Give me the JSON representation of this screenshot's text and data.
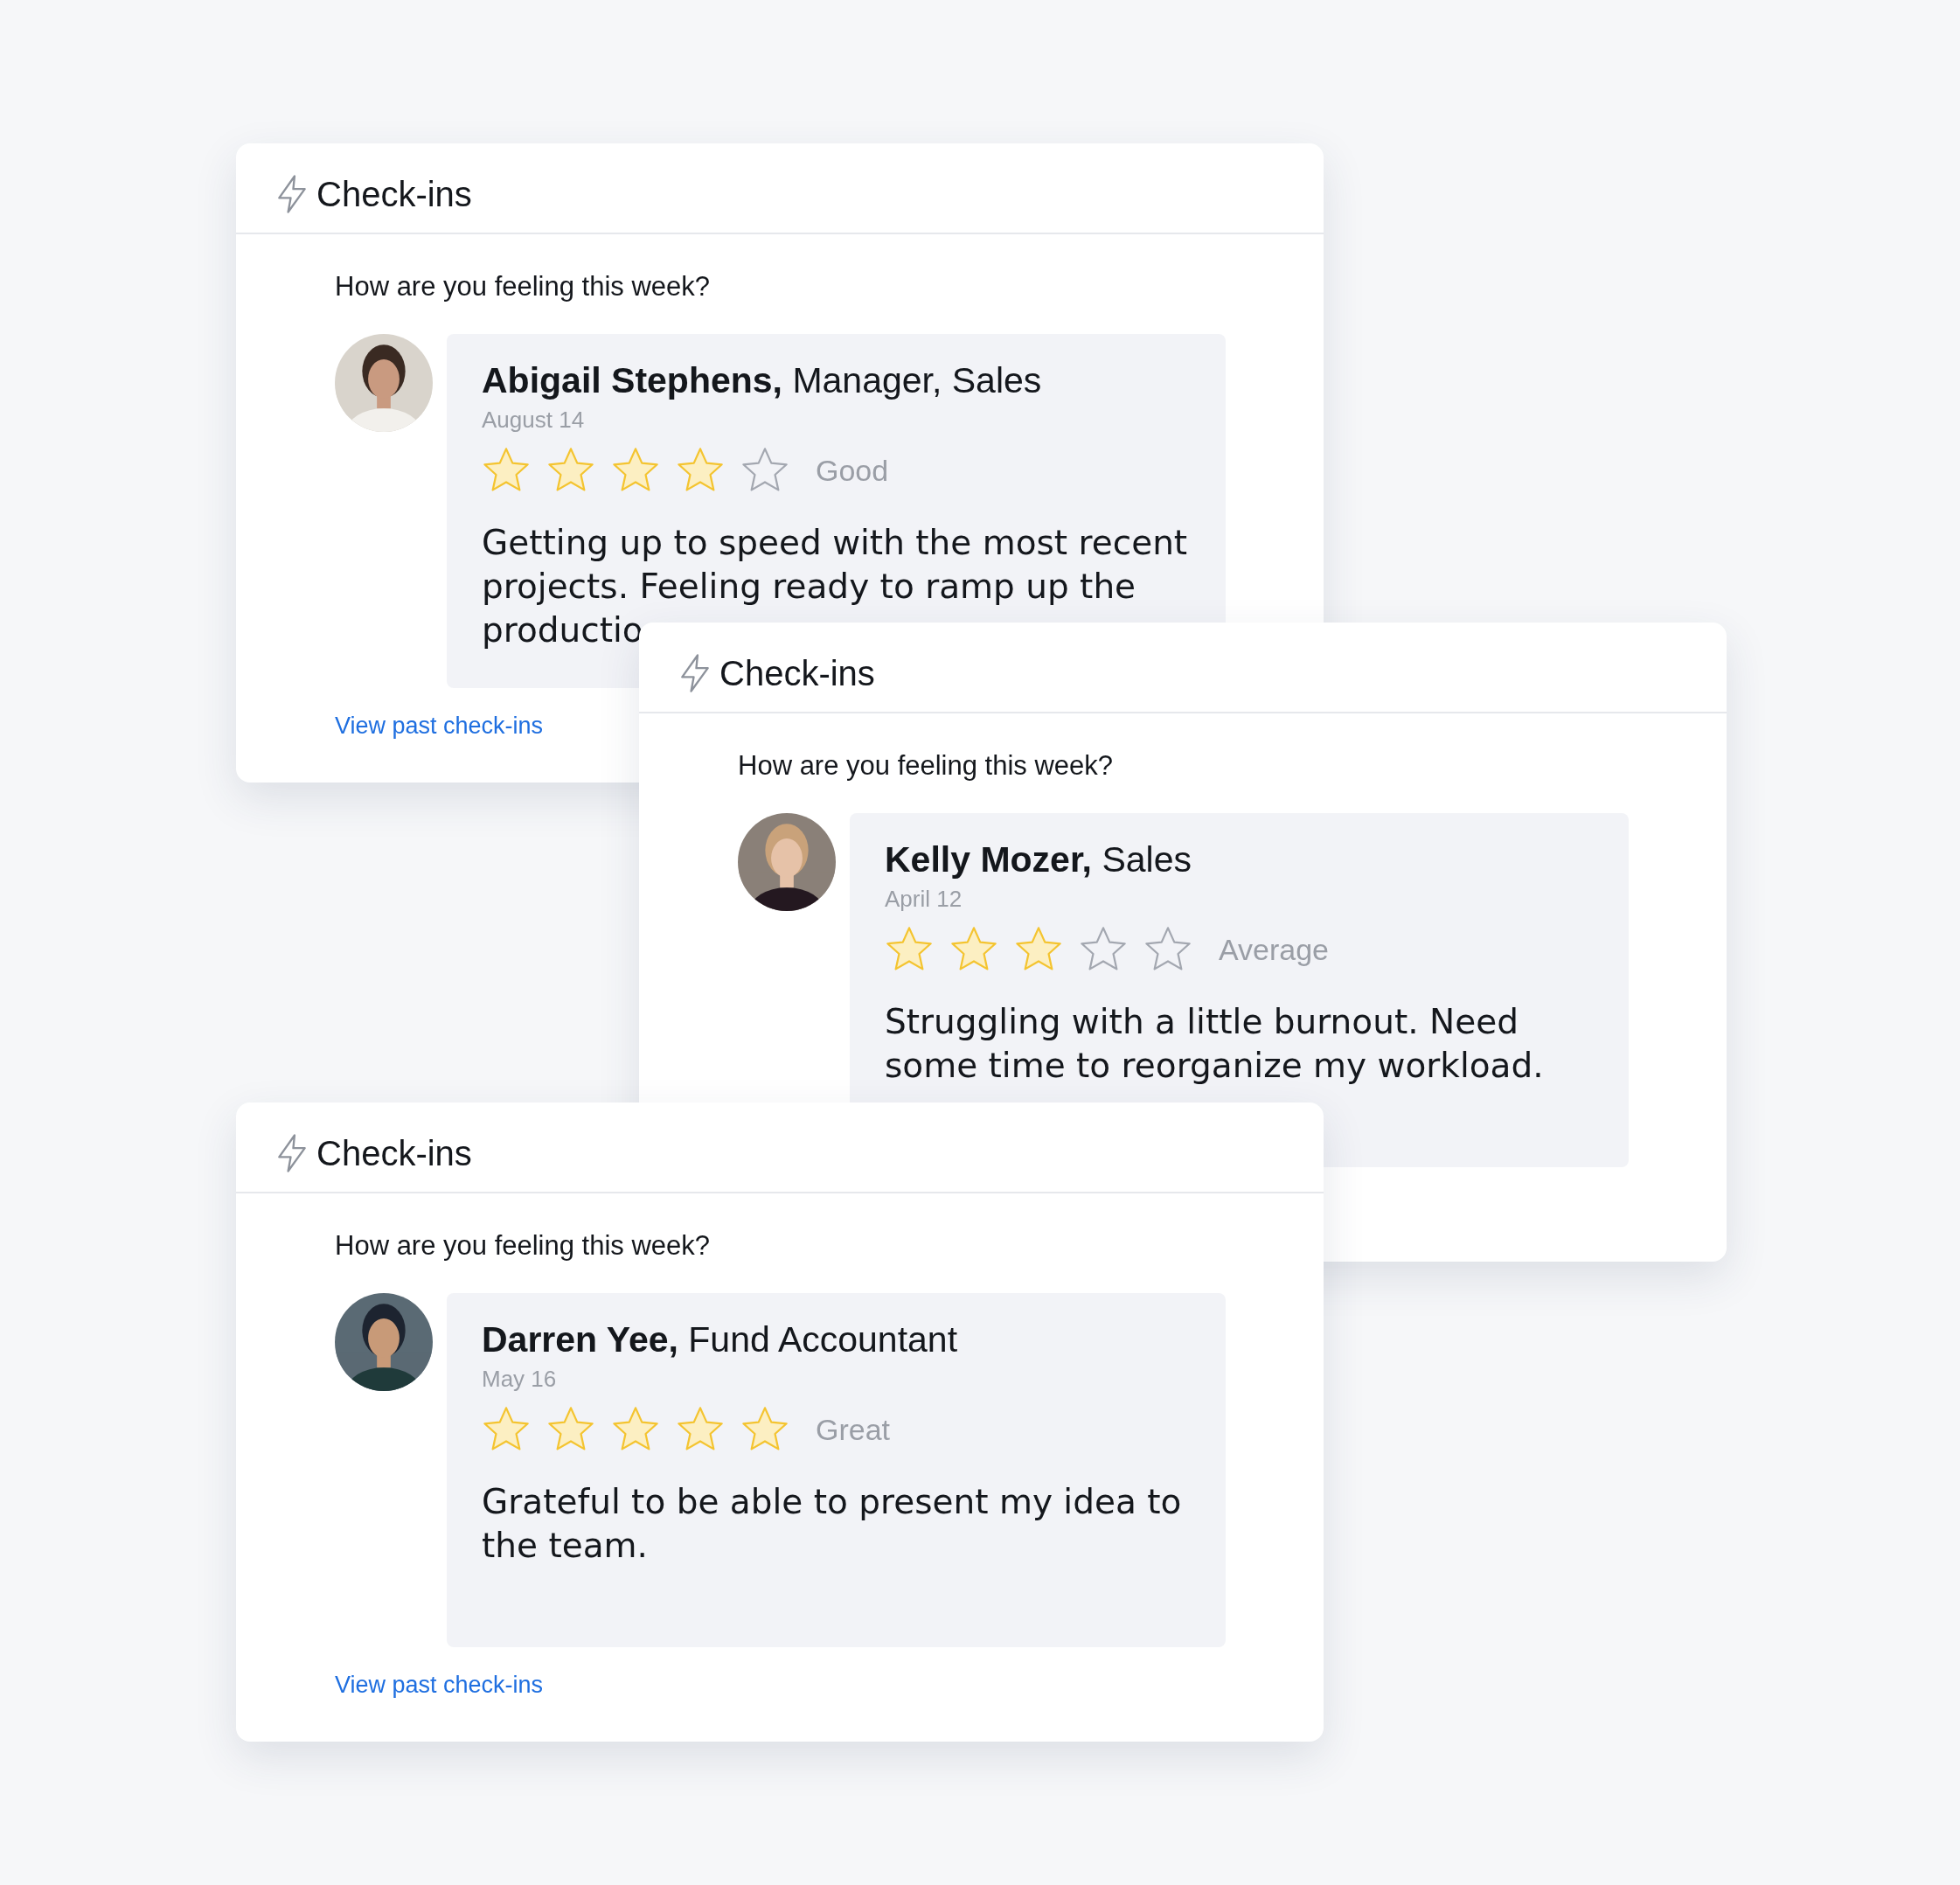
{
  "cards": [
    {
      "title": "Check-ins",
      "question": "How are you feeling this week?",
      "checkin": {
        "person": "**Abigail Stephens,** Manager, Sales",
        "date": "August 14",
        "stars": 4,
        "rating": "Good",
        "comment": "Getting up to speed with the most recent projects. Feeling ready to ramp up the productio"
      },
      "link": "View past check-ins"
    },
    {
      "title": "Check-ins",
      "question": "How are you feeling this week?",
      "checkin": {
        "person": "**Kelly Mozer,** Sales",
        "date": "April 12",
        "stars": 3,
        "rating": "Average",
        "comment": "Struggling with a little burnout. Need some time to reorganize my workload."
      }
    },
    {
      "title": "Check-ins",
      "question": "How are you feeling this week?",
      "checkin": {
        "person": "**Darren Yee,** Fund Accountant",
        "date": "May 16",
        "stars": 5,
        "rating": "Great",
        "comment": "Grateful to be able to present my idea to the team."
      },
      "link": "View past check-ins"
    }
  ]
}
